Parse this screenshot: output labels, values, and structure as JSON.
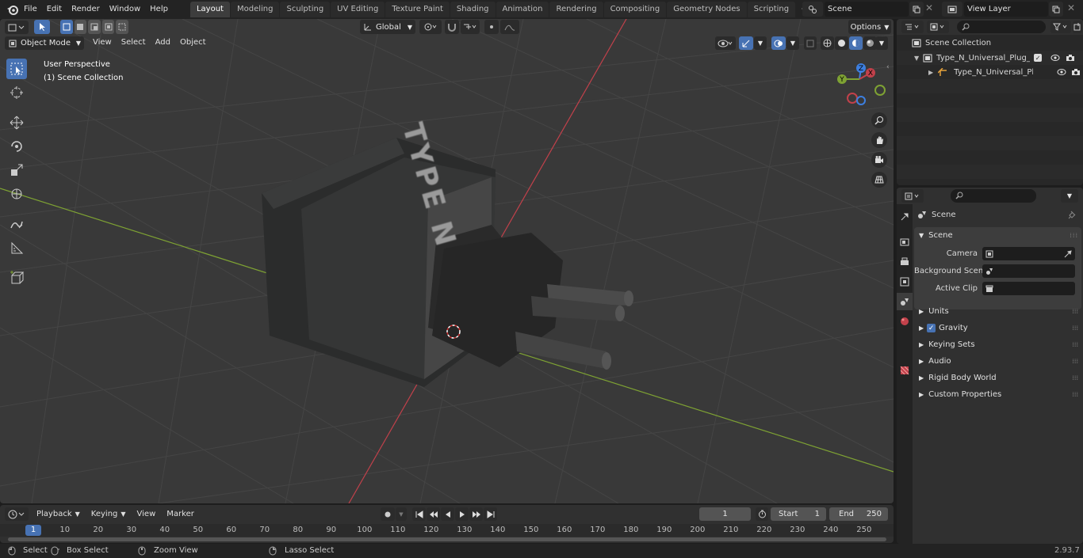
{
  "topbar": {
    "menus": [
      "File",
      "Edit",
      "Render",
      "Window",
      "Help"
    ],
    "workspaces": [
      "Layout",
      "Modeling",
      "Sculpting",
      "UV Editing",
      "Texture Paint",
      "Shading",
      "Animation",
      "Rendering",
      "Compositing",
      "Geometry Nodes",
      "Scripting"
    ],
    "active_workspace": "Layout",
    "add_tab": "+",
    "scene_name": "Scene",
    "view_layer": "View Layer"
  },
  "viewport": {
    "mode": "Object Mode",
    "menus": [
      "View",
      "Select",
      "Add",
      "Object"
    ],
    "transform_orientation": "Global",
    "options": "Options",
    "overlay_line1": "User Perspective",
    "overlay_line2": "(1) Scene Collection",
    "model_text": "TYPE N",
    "gizmo": {
      "x": "X",
      "y": "Y",
      "z": "Z"
    }
  },
  "timeline": {
    "menus": [
      "Playback",
      "Keying",
      "View",
      "Marker"
    ],
    "current_frame": "1",
    "start_label": "Start",
    "start": "1",
    "end_label": "End",
    "end": "250",
    "ruler": [
      "1",
      "10",
      "20",
      "30",
      "40",
      "50",
      "60",
      "70",
      "80",
      "90",
      "100",
      "110",
      "120",
      "130",
      "140",
      "150",
      "160",
      "170",
      "180",
      "190",
      "200",
      "210",
      "220",
      "230",
      "240",
      "250"
    ],
    "frame_highlight": "1"
  },
  "status": {
    "select": "Select",
    "box_select": "Box Select",
    "zoom_view": "Zoom View",
    "lasso_select": "Lasso Select",
    "version": "2.93.7"
  },
  "outliner": {
    "root": "Scene Collection",
    "items": [
      {
        "label": "Type_N_Universal_Plug_Adap"
      },
      {
        "label": "Type_N_Universal_Plug_A"
      }
    ]
  },
  "properties": {
    "context": "Scene",
    "section": "Scene",
    "fields": [
      {
        "label": "Camera",
        "value": ""
      },
      {
        "label": "Background Scene",
        "value": ""
      },
      {
        "label": "Active Clip",
        "value": ""
      }
    ],
    "panels": [
      "Units",
      "Gravity",
      "Keying Sets",
      "Audio",
      "Rigid Body World",
      "Custom Properties"
    ]
  },
  "colors": {
    "accent": "#4772b3",
    "x_axis": "#c2414b",
    "y_axis": "#7ea233",
    "viewport_bg": "#393939"
  }
}
